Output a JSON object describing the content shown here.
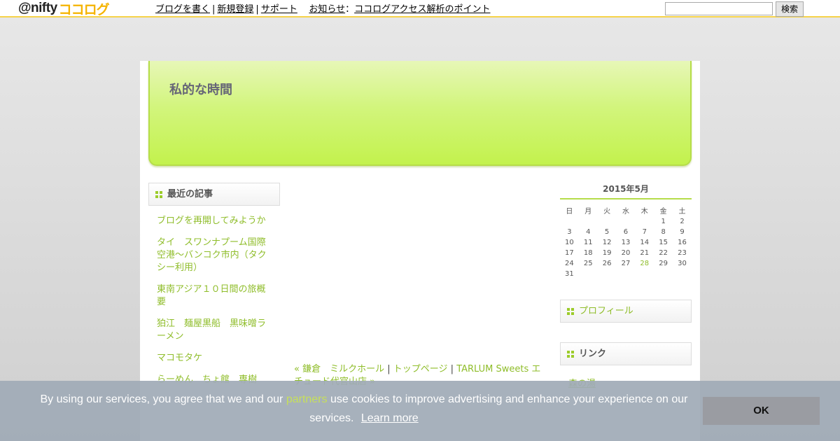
{
  "topbar": {
    "logo_prefix": "@nifty",
    "logo_brand": "ココログ",
    "nav": [
      {
        "label": "ブログを書く"
      },
      {
        "label": "新規登録"
      },
      {
        "label": "サポート"
      },
      {
        "label": "お知らせ"
      },
      {
        "label": "ココログアクセス解析のポイント"
      }
    ],
    "sep_pipe": "|",
    "sep_colon": "：",
    "search_value": "",
    "search_button": "検索"
  },
  "blog": {
    "title": "私的な時間"
  },
  "sidebar_left": {
    "heading": "最近の記事",
    "items": [
      "ブログを再開してみようか",
      "タイ　スワンナプーム国際空港～バンコク市内（タクシー利用）",
      "東南アジア１０日間の旅概要",
      "狛江　麺屋黒船　黒味噌ラーメン",
      "マコモタケ",
      "らーめん　ちょ館　専樹"
    ]
  },
  "center": {
    "prev": "« 鎌倉　ミルクホール",
    "sep": "|",
    "top": "トップページ",
    "next": "TARLUM Sweets エチュード代官山店 »"
  },
  "calendar": {
    "title": "2015年5月",
    "weekdays": [
      "日",
      "月",
      "火",
      "水",
      "木",
      "金",
      "土"
    ],
    "weeks": [
      [
        "",
        "",
        "",
        "",
        "",
        "1",
        "2"
      ],
      [
        "3",
        "4",
        "5",
        "6",
        "7",
        "8",
        "9"
      ],
      [
        "10",
        "11",
        "12",
        "13",
        "14",
        "15",
        "16"
      ],
      [
        "17",
        "18",
        "19",
        "20",
        "21",
        "22",
        "23"
      ],
      [
        "24",
        "25",
        "26",
        "27",
        "28",
        "29",
        "30"
      ],
      [
        "31",
        "",
        "",
        "",
        "",
        "",
        ""
      ]
    ],
    "linked_day": "28"
  },
  "sidebar_right": {
    "profile_heading": "プロフィール",
    "links_heading": "リンク",
    "link_item": "森の湯"
  },
  "cookie": {
    "text_before": "By using our services, you agree that we and our ",
    "partners": "partners",
    "text_after": " use cookies to improve advertising and enhance your experience on our services.",
    "learn_more": "Learn more",
    "ok": "OK"
  },
  "colors": {
    "accent_green": "#8fbd2a",
    "banner_green": "#c3f24d",
    "topbar_line": "#f6d34a"
  }
}
